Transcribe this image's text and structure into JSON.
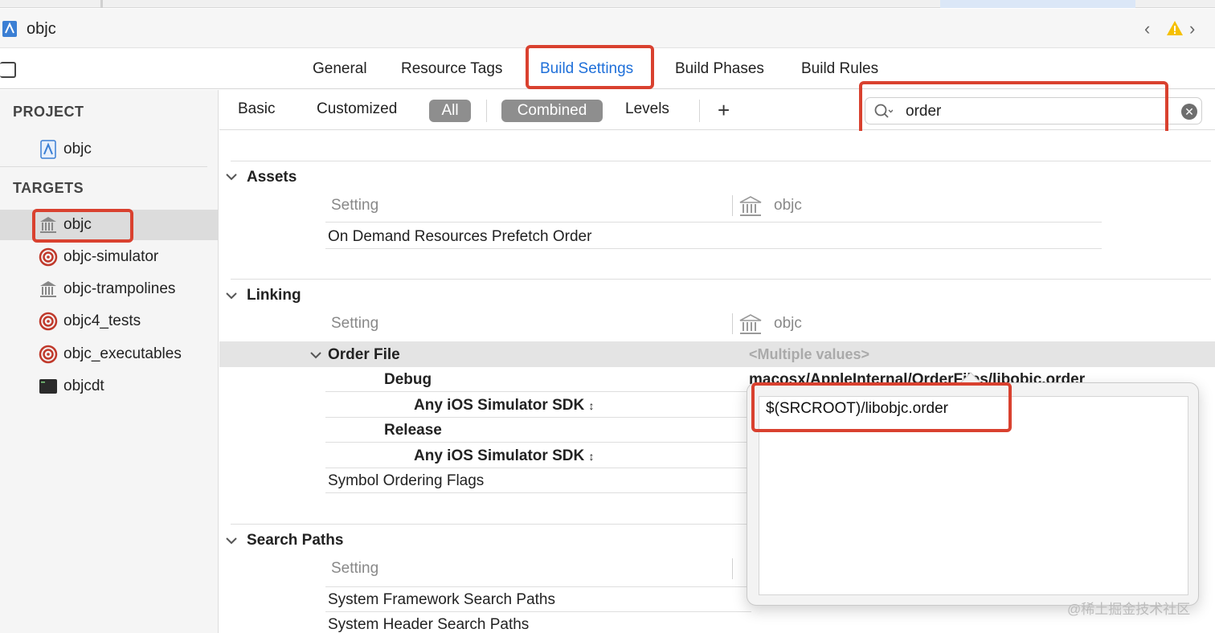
{
  "window": {
    "title": "objc"
  },
  "tabs": [
    "General",
    "Resource Tags",
    "Build Settings",
    "Build Phases",
    "Build Rules"
  ],
  "active_tab": "Build Settings",
  "sidebar": {
    "project_header": "PROJECT",
    "project_items": [
      {
        "label": "objc",
        "icon": "project-file-icon"
      }
    ],
    "targets_header": "TARGETS",
    "target_items": [
      {
        "label": "objc",
        "icon": "library-icon",
        "selected": true
      },
      {
        "label": "objc-simulator",
        "icon": "target-icon"
      },
      {
        "label": "objc-trampolines",
        "icon": "library-icon"
      },
      {
        "label": "objc4_tests",
        "icon": "target-icon"
      },
      {
        "label": "objc_executables",
        "icon": "target-icon"
      },
      {
        "label": "objcdt",
        "icon": "terminal-icon"
      }
    ]
  },
  "filter": {
    "basic": "Basic",
    "customized": "Customized",
    "all": "All",
    "combined": "Combined",
    "levels": "Levels",
    "add": "+",
    "search_value": "order"
  },
  "sections": {
    "assets": {
      "title": "Assets",
      "col_setting": "Setting",
      "col_target": "objc",
      "rows": [
        "On Demand Resources Prefetch Order"
      ]
    },
    "linking": {
      "title": "Linking",
      "col_setting": "Setting",
      "col_target": "objc",
      "order_file": "Order File",
      "multiple_values": "<Multiple values>",
      "debug": "Debug",
      "debug_value": "macosx/AppleInternal/OrderFiles/libobjc.order",
      "any_sdk_1": "Any iOS Simulator SDK",
      "release": "Release",
      "any_sdk_2": "Any iOS Simulator SDK",
      "symbol_flags": "Symbol Ordering Flags"
    },
    "search_paths": {
      "title": "Search Paths",
      "col_setting": "Setting",
      "rows": [
        "System Framework Search Paths",
        "System Header Search Paths"
      ]
    }
  },
  "popover": {
    "value": "$(SRCROOT)/libobjc.order"
  },
  "watermark": "@稀土掘金技术社区",
  "colors": {
    "accent": "#1e6fd9",
    "highlight_box": "#d9412f",
    "pill": "#8e8e8e"
  }
}
